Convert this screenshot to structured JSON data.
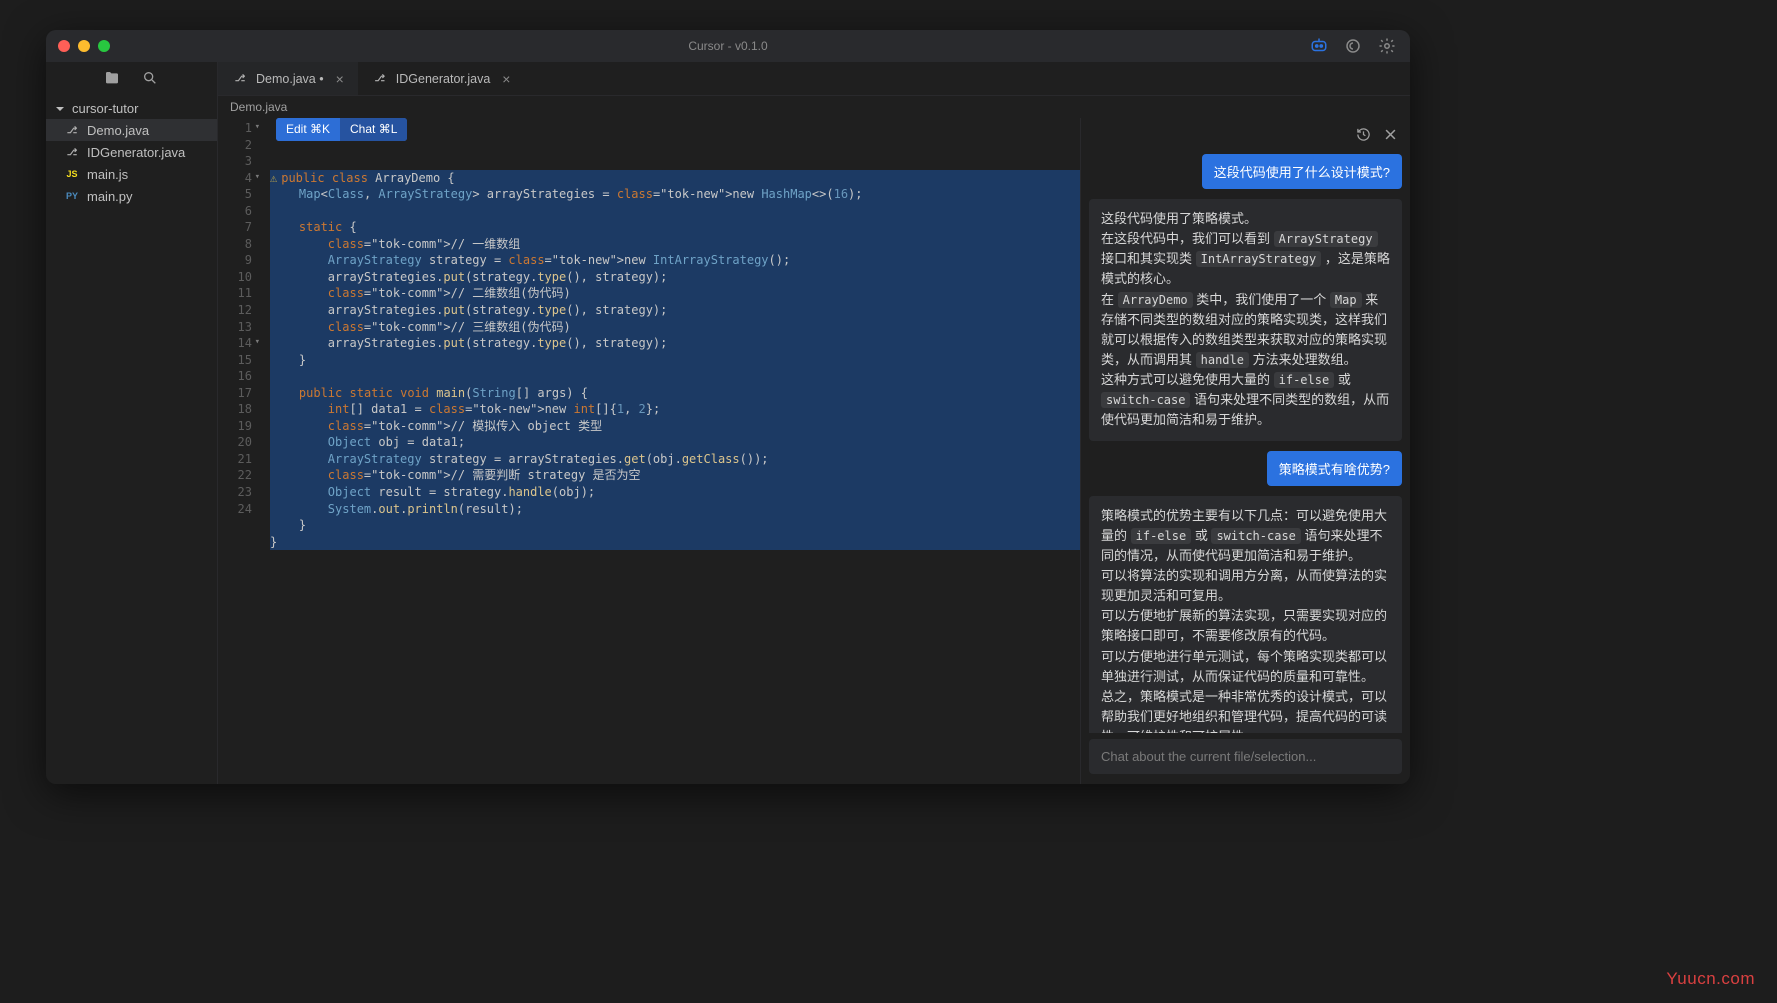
{
  "window": {
    "title": "Cursor - v0.1.0"
  },
  "sidebar": {
    "root": "cursor-tutor",
    "items": [
      {
        "label": "Demo.java",
        "lang": "java",
        "active": true
      },
      {
        "label": "IDGenerator.java",
        "lang": "java",
        "active": false
      },
      {
        "label": "main.js",
        "lang": "js",
        "active": false
      },
      {
        "label": "main.py",
        "lang": "py",
        "active": false
      }
    ]
  },
  "tabs": [
    {
      "label": "Demo.java",
      "modified": true,
      "active": true
    },
    {
      "label": "IDGenerator.java",
      "modified": false,
      "active": false
    }
  ],
  "breadcrumb": "Demo.java",
  "action_popup": {
    "edit": "Edit ⌘K",
    "chat": "Chat ⌘L"
  },
  "code_lines": [
    "public class ArrayDemo {",
    "    Map<Class, ArrayStrategy> arrayStrategies = new HashMap<>(16);",
    "",
    "    static {",
    "        // 一维数组",
    "        ArrayStrategy strategy = new IntArrayStrategy();",
    "        arrayStrategies.put(strategy.type(), strategy);",
    "        // 二维数组(伪代码)",
    "        arrayStrategies.put(strategy.type(), strategy);",
    "        // 三维数组(伪代码)",
    "        arrayStrategies.put(strategy.type(), strategy);",
    "    }",
    "",
    "    public static void main(String[] args) {",
    "        int[] data1 = new int[]{1, 2};",
    "        // 模拟传入 object 类型",
    "        Object obj = data1;",
    "        ArrayStrategy strategy = arrayStrategies.get(obj.getClass());",
    "        // 需要判断 strategy 是否为空",
    "        Object result = strategy.handle(obj);",
    "        System.out.println(result);",
    "    }",
    "}",
    ""
  ],
  "line_count": 24,
  "chat": {
    "messages": [
      {
        "role": "user",
        "text": "这段代码使用了什么设计模式?"
      },
      {
        "role": "ai",
        "text_parts": [
          "这段代码使用了策略模式。",
          "在这段代码中，我们可以看到 ",
          {
            "code": "ArrayStrategy"
          },
          " 接口和其实现类 ",
          {
            "code": "IntArrayStrategy"
          },
          " ，这是策略模式的核心。在 ",
          {
            "code": "ArrayDemo"
          },
          " 类中，我们使用了一个 ",
          {
            "code": "Map"
          },
          " 来存储不同类型的数组对应的策略实现类，这样我们就可以根据传入的数组类型来获取对应的策略实现类，从而调用其 ",
          {
            "code": "handle"
          },
          " 方法来处理数组。",
          "这种方式可以避免使用大量的 ",
          {
            "code": "if-else"
          },
          " 或 ",
          {
            "code": "switch-case"
          },
          " 语句来处理不同类型的数组，从而使代码更加简洁和易于维护。"
        ]
      },
      {
        "role": "user",
        "text": "策略模式有啥优势?"
      },
      {
        "role": "ai",
        "text_parts": [
          "策略模式的优势主要有以下几点：",
          "可以避免使用大量的 ",
          {
            "code": "if-else"
          },
          " 或 ",
          {
            "code": "switch-case"
          },
          " 语句来处理不同的情况，从而使代码更加简洁和易于维护。",
          "可以将算法的实现和调用方分离，从而使算法的实现更加灵活和可复用。",
          "可以方便地扩展新的算法实现，只需要实现对应的策略接口即可，不需要修改原有的代码。",
          "可以方便地进行单元测试，每个策略实现类都可以单独进行测试，从而保证代码的质量和可靠性。",
          "总之，策略模式是一种非常优秀的设计模式，可以帮助我们更好地组织和管理代码，提高代码的可读性、可维护性和可扩展性。"
        ]
      }
    ],
    "input_placeholder": "Chat about the current file/selection..."
  },
  "watermark": "Yuucn.com"
}
